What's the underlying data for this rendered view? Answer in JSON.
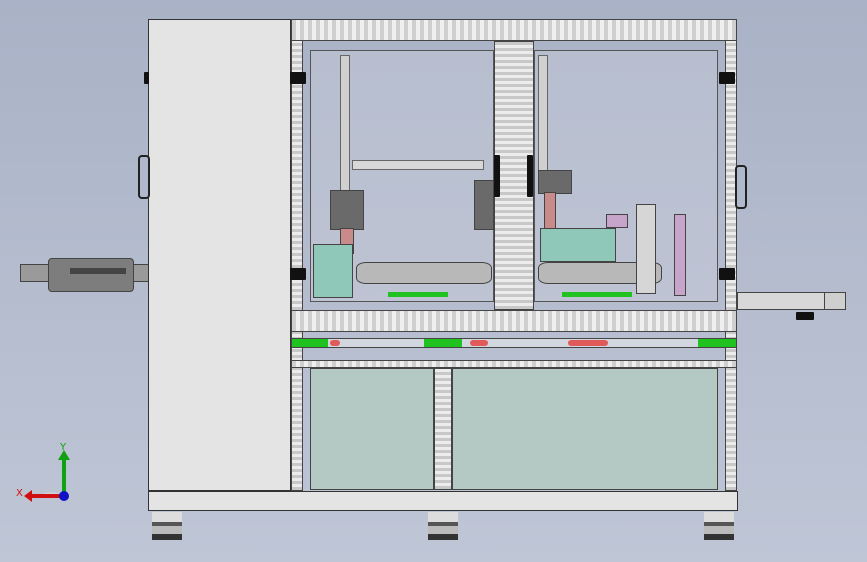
{
  "viewport": {
    "title": "",
    "background_gradient": [
      "#a9b2c6",
      "#bfc6d6"
    ]
  },
  "model": {
    "name": "",
    "colors": {
      "frame": "#e4e4e4",
      "glass_panel": "#b4c9c4",
      "indicator_green": "#1fc21f",
      "indicator_red": "#e05a5a",
      "teal_part": "#8fc7b8",
      "pink_part": "#c98a8a",
      "violet_part": "#c7a4c9"
    }
  },
  "triad": {
    "icon": "coordinate-triad-icon",
    "x_label": "X",
    "y_label": "Y",
    "colors": {
      "x": "#d01010",
      "y": "#10a010",
      "z": "#1010c8"
    }
  }
}
